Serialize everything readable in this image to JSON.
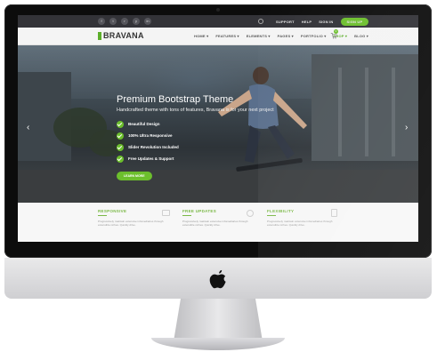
{
  "topbar": {
    "social_icons": [
      {
        "name": "facebook-icon",
        "glyph": "f"
      },
      {
        "name": "twitter-icon",
        "glyph": "t"
      },
      {
        "name": "rss-icon",
        "glyph": "r"
      },
      {
        "name": "youtube-icon",
        "glyph": "y"
      },
      {
        "name": "linkedin-icon",
        "glyph": "in"
      }
    ],
    "links": [
      "SUPPORT",
      "HELP",
      "SIGN IN"
    ],
    "signup_label": "SIGN UP"
  },
  "nav": {
    "logo": "BRAVANA",
    "menu": [
      "HOME ▾",
      "FEATURES ▾",
      "ELEMENTS ▾",
      "PAGES ▾",
      "PORTFOLIO ▾",
      "SHOP ▾",
      "BLOG ▾"
    ],
    "active_menu_index": 5,
    "cart_count": "0"
  },
  "hero": {
    "title": "Premium Bootstrap Theme",
    "subtitle": "Handcrafted theme with tons of features, Bravana is for your next project",
    "features": [
      "Beautiful Design",
      "100% Ultra Responsive",
      "Slider Revolution Included",
      "Free Updates & Support"
    ],
    "button_label": "LEARN MORE",
    "prev_arrow": "‹",
    "next_arrow": "›"
  },
  "strip": {
    "columns": [
      {
        "title": "RESPONSIVE",
        "text": "Progressively maintain extensive infomediaries through extensible niches. Quickly drive."
      },
      {
        "title": "FREE UPDATES",
        "text": "Progressively maintain extensive infomediaries through extensible niches. Quickly drive."
      },
      {
        "title": "FLEXIBILITY",
        "text": "Progressively maintain extensive infomediaries through extensible niches. Quickly drive."
      }
    ]
  },
  "colors": {
    "accent": "#6cbf2c",
    "topbar": "#333338",
    "bezel": "#0c0c0c"
  }
}
